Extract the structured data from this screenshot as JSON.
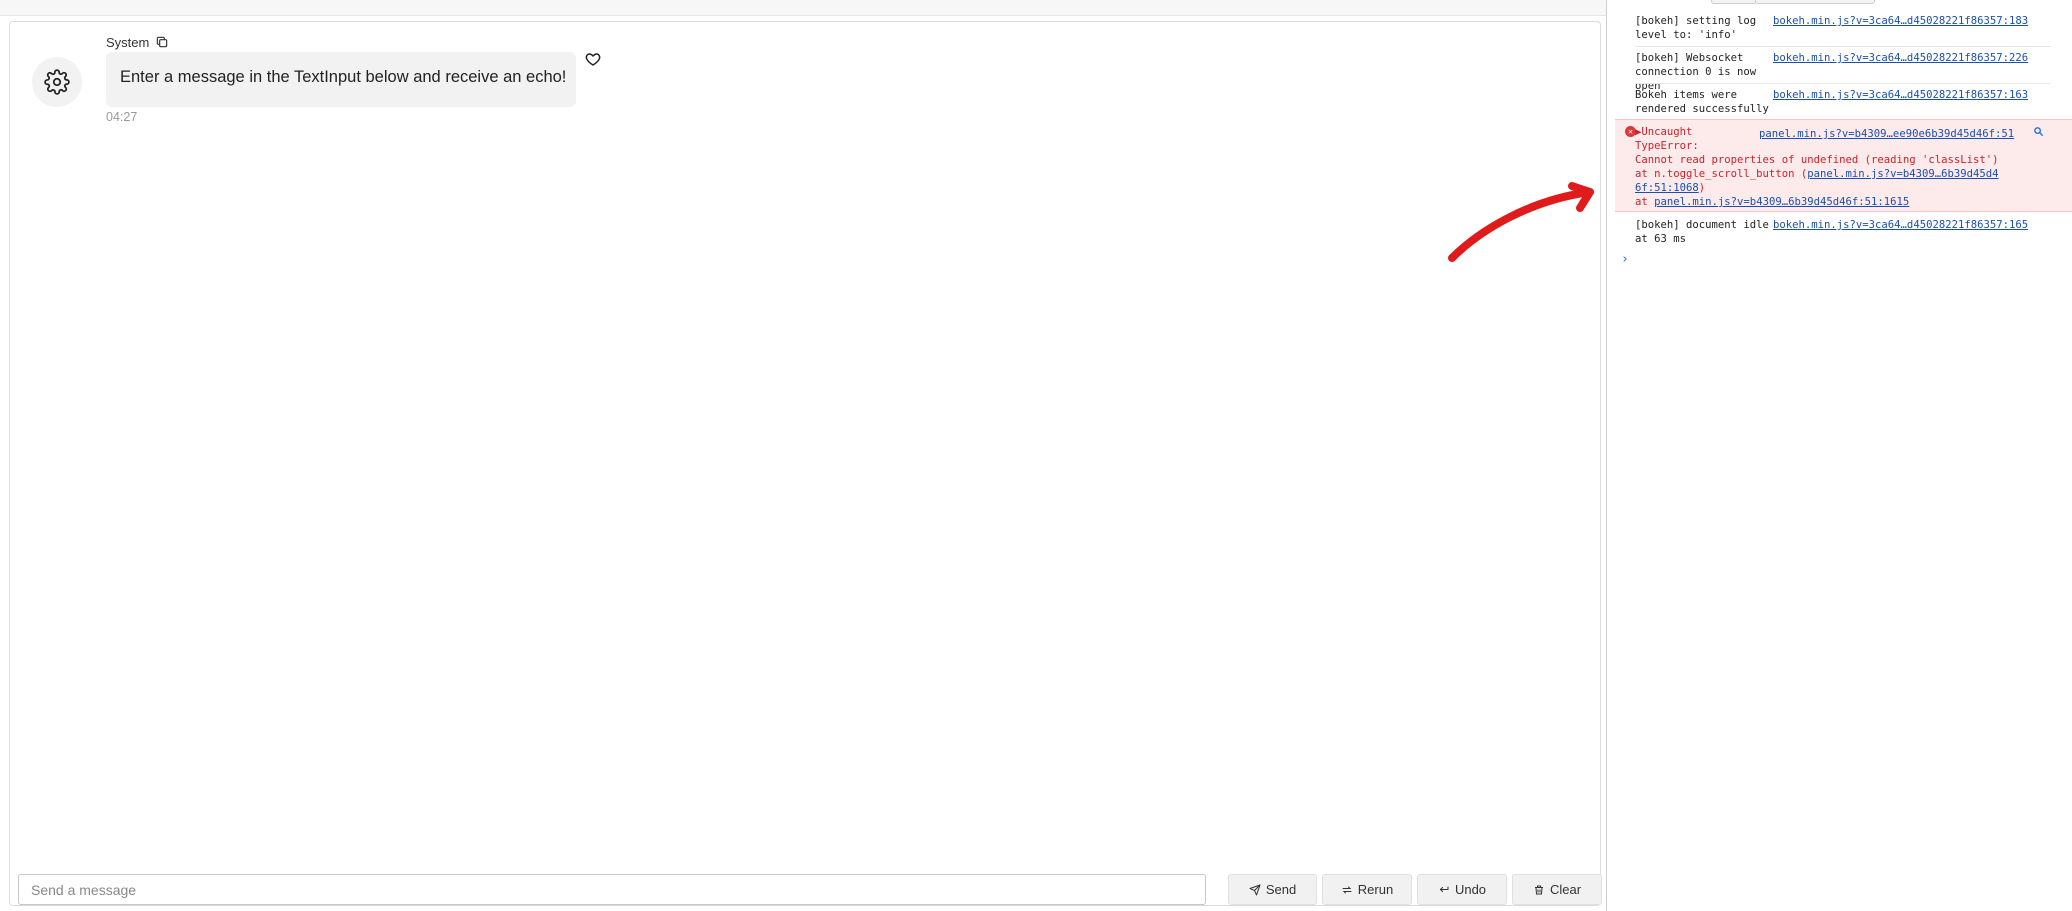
{
  "chat": {
    "author": "System",
    "message": "Enter a message in the TextInput below and receive an echo!",
    "timestamp": "04:27",
    "input_placeholder": "Send a message",
    "buttons": {
      "send": "Send",
      "rerun": "Rerun",
      "undo": "Undo",
      "clear": "Clear"
    }
  },
  "console": {
    "logs": [
      {
        "msg": "[bokeh] setting log level to: 'info'",
        "src": "bokeh.min.js?v=3ca64…d45028221f86357:183"
      },
      {
        "msg": "[bokeh] Websocket connection 0 is now open",
        "src": "bokeh.min.js?v=3ca64…d45028221f86357:226"
      },
      {
        "msg": "Bokeh items were rendered successfully",
        "src": "bokeh.min.js?v=3ca64…d45028221f86357:163"
      }
    ],
    "error": {
      "head": "▶Uncaught",
      "type": "TypeError:",
      "message": "Cannot read properties of undefined (reading 'classList')",
      "src": "panel.min.js?v=b4309…ee90e6b39d45d46f:51",
      "stack1_prefix": "    at n.toggle_scroll_button (",
      "stack1_link": "panel.min.js?v=b4309…6b39d45d4",
      "stack1_link2": "6f:51:1068",
      "stack1_suffix": ")",
      "stack2_prefix": "    at ",
      "stack2_link": "panel.min.js?v=b4309…6b39d45d46f:51:1615"
    },
    "last_log": {
      "msg": "[bokeh] document idle at 63 ms",
      "src": "bokeh.min.js?v=3ca64…d45028221f86357:165"
    },
    "prompt": "›"
  },
  "colors": {
    "error_text": "#d0202a",
    "error_bg": "#fdeaea",
    "link": "#1a4fb0",
    "annotation_arrow": "#e01b1b"
  }
}
